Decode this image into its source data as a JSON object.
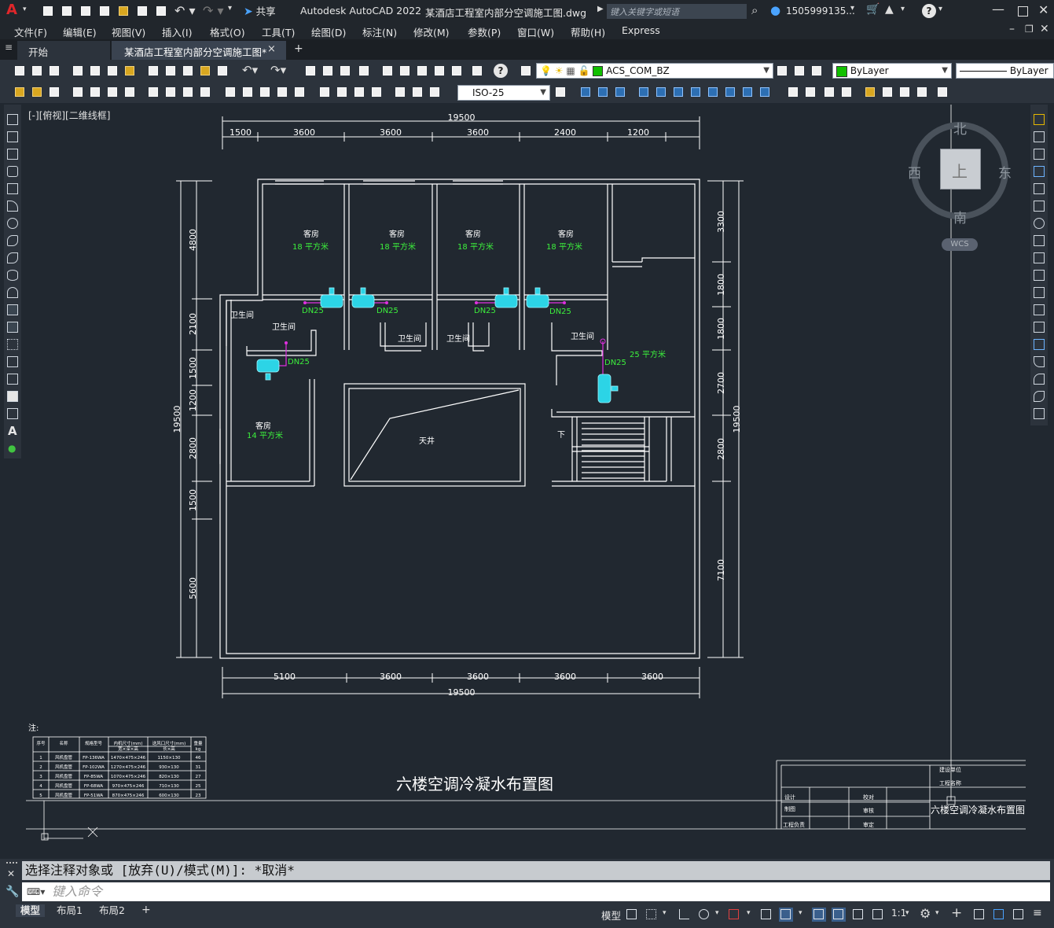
{
  "app": {
    "logo": "A",
    "title": "Autodesk AutoCAD 2022",
    "filename": "某酒店工程室内部分空调施工图.dwg",
    "share_label": "共享",
    "search_placeholder": "键入关键字或短语",
    "user": "1505999135...",
    "help": "?"
  },
  "menu": [
    "文件(F)",
    "编辑(E)",
    "视图(V)",
    "插入(I)",
    "格式(O)",
    "工具(T)",
    "绘图(D)",
    "标注(N)",
    "修改(M)",
    "参数(P)",
    "窗口(W)",
    "帮助(H)",
    "Express"
  ],
  "tabs": {
    "start": "开始",
    "active": "某酒店工程室内部分空调施工图*",
    "close": "×",
    "add": "+"
  },
  "toolbar": {
    "layer": "ACS_COM_BZ",
    "color": "ByLayer",
    "linetype": "ByLayer",
    "dimstyle": "ISO-25",
    "layer_color": "#12c000"
  },
  "viewport_label": "[-][俯视][二维线框]",
  "viewcube": {
    "north": "北",
    "south": "南",
    "east": "东",
    "west": "西",
    "top": "上",
    "wcs": "WCS"
  },
  "drawing": {
    "dims_top": [
      "1500",
      "3600",
      "3600",
      "3600",
      "2400",
      "1200"
    ],
    "dim_top_total": "19500",
    "dims_bottom": [
      "5100",
      "3600",
      "3600",
      "3600",
      "3600"
    ],
    "dim_bottom_total": "19500",
    "dims_left": [
      "4800",
      "2100",
      "1500",
      "1200",
      "2800",
      "1500",
      "5600"
    ],
    "dim_left_total": "19500",
    "dims_right": [
      "3300",
      "1800",
      "1800",
      "2700",
      "2800",
      "7100"
    ],
    "dim_right_total": "19500",
    "rooms": {
      "guest": "客房",
      "area18": "18 平方米",
      "area14": "14 平方米",
      "area25": "25 平方米",
      "bath": "卫生间",
      "atrium": "天井",
      "down": "下"
    },
    "pipe_label": "DN25",
    "plan_title": "六楼空调冷凝水布置图",
    "note": "注:",
    "table": {
      "headers": [
        "序号",
        "名称",
        "规格型号",
        "内机尺寸(mm)",
        "送风口尺寸(mm)",
        "重量"
      ],
      "subheaders": [
        "宽×深×高",
        "长×高",
        "kg"
      ],
      "rows": [
        [
          "1",
          "风机盘管",
          "FP-136WA",
          "1470×475×246",
          "1150×130",
          "46"
        ],
        [
          "2",
          "风机盘管",
          "FP-102WA",
          "1270×475×246",
          "930×130",
          "31"
        ],
        [
          "3",
          "风机盘管",
          "FP-85WA",
          "1070×475×246",
          "820×130",
          "27"
        ],
        [
          "4",
          "风机盘管",
          "FP-68WA",
          "970×475×246",
          "710×130",
          "25"
        ],
        [
          "5",
          "风机盘管",
          "FP-51WA",
          "870×475×246",
          "600×130",
          "23"
        ]
      ]
    },
    "titleblock": {
      "build_unit": "建设单位",
      "project_name": "工程名称",
      "design": "设计",
      "draw": "制图",
      "lead": "工程负责",
      "check": "校对",
      "review": "审核",
      "approve": "审定",
      "sheet_title": "六楼空调冷凝水布置图"
    }
  },
  "command": {
    "history": "选择注释对象或 [放弃(U)/模式(M)]: *取消*",
    "placeholder": "键入命令"
  },
  "status": {
    "tabs": [
      "模型",
      "布局1",
      "布局2"
    ],
    "add": "+",
    "model": "模型",
    "scale": "1:1"
  }
}
